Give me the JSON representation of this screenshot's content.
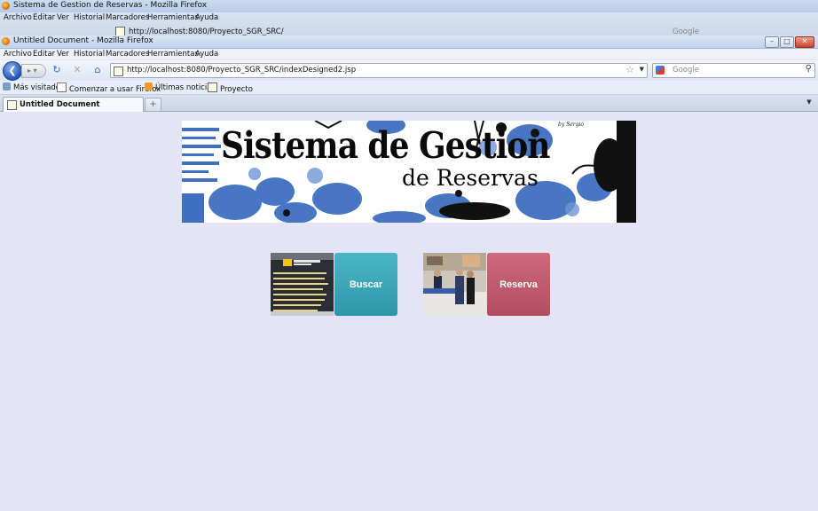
{
  "bg_window": {
    "title": "Sistema de Gestion de Reservas - Mozilla Firefox",
    "menu": [
      "Archivo",
      "Editar",
      "Ver",
      "Historial",
      "Marcadores",
      "Herramientas",
      "Ayuda"
    ],
    "url": "http://localhost:8080/Proyecto_SGR_SRC/",
    "search_placeholder": "Google"
  },
  "window": {
    "title": "Untitled Document - Mozilla Firefox",
    "controls": {
      "minimize": "–",
      "maximize": "□",
      "close": "✕"
    }
  },
  "menu": [
    "Archivo",
    "Editar",
    "Ver",
    "Historial",
    "Marcadores",
    "Herramientas",
    "Ayuda"
  ],
  "nav": {
    "url": "http://localhost:8080/Proyecto_SGR_SRC/indexDesigned2.jsp",
    "search_placeholder": "Google"
  },
  "bookmarks": [
    "Más visitados",
    "Comenzar a usar Firefox",
    "Últimas noticias",
    "Proyecto"
  ],
  "tabs": [
    {
      "label": "Untitled Document"
    }
  ],
  "banner": {
    "title_line1": "Sistema de Gestion",
    "title_line2": "de Reservas",
    "credit": "by Sergio"
  },
  "actions": {
    "buscar": "Buscar",
    "reserva": "Reserva"
  },
  "colors": {
    "page_bg": "#e4e4f6",
    "buscar_tile": "#3aa6b8",
    "reserva_tile": "#c05a6c",
    "banner_blue": "#3f6fc0"
  }
}
